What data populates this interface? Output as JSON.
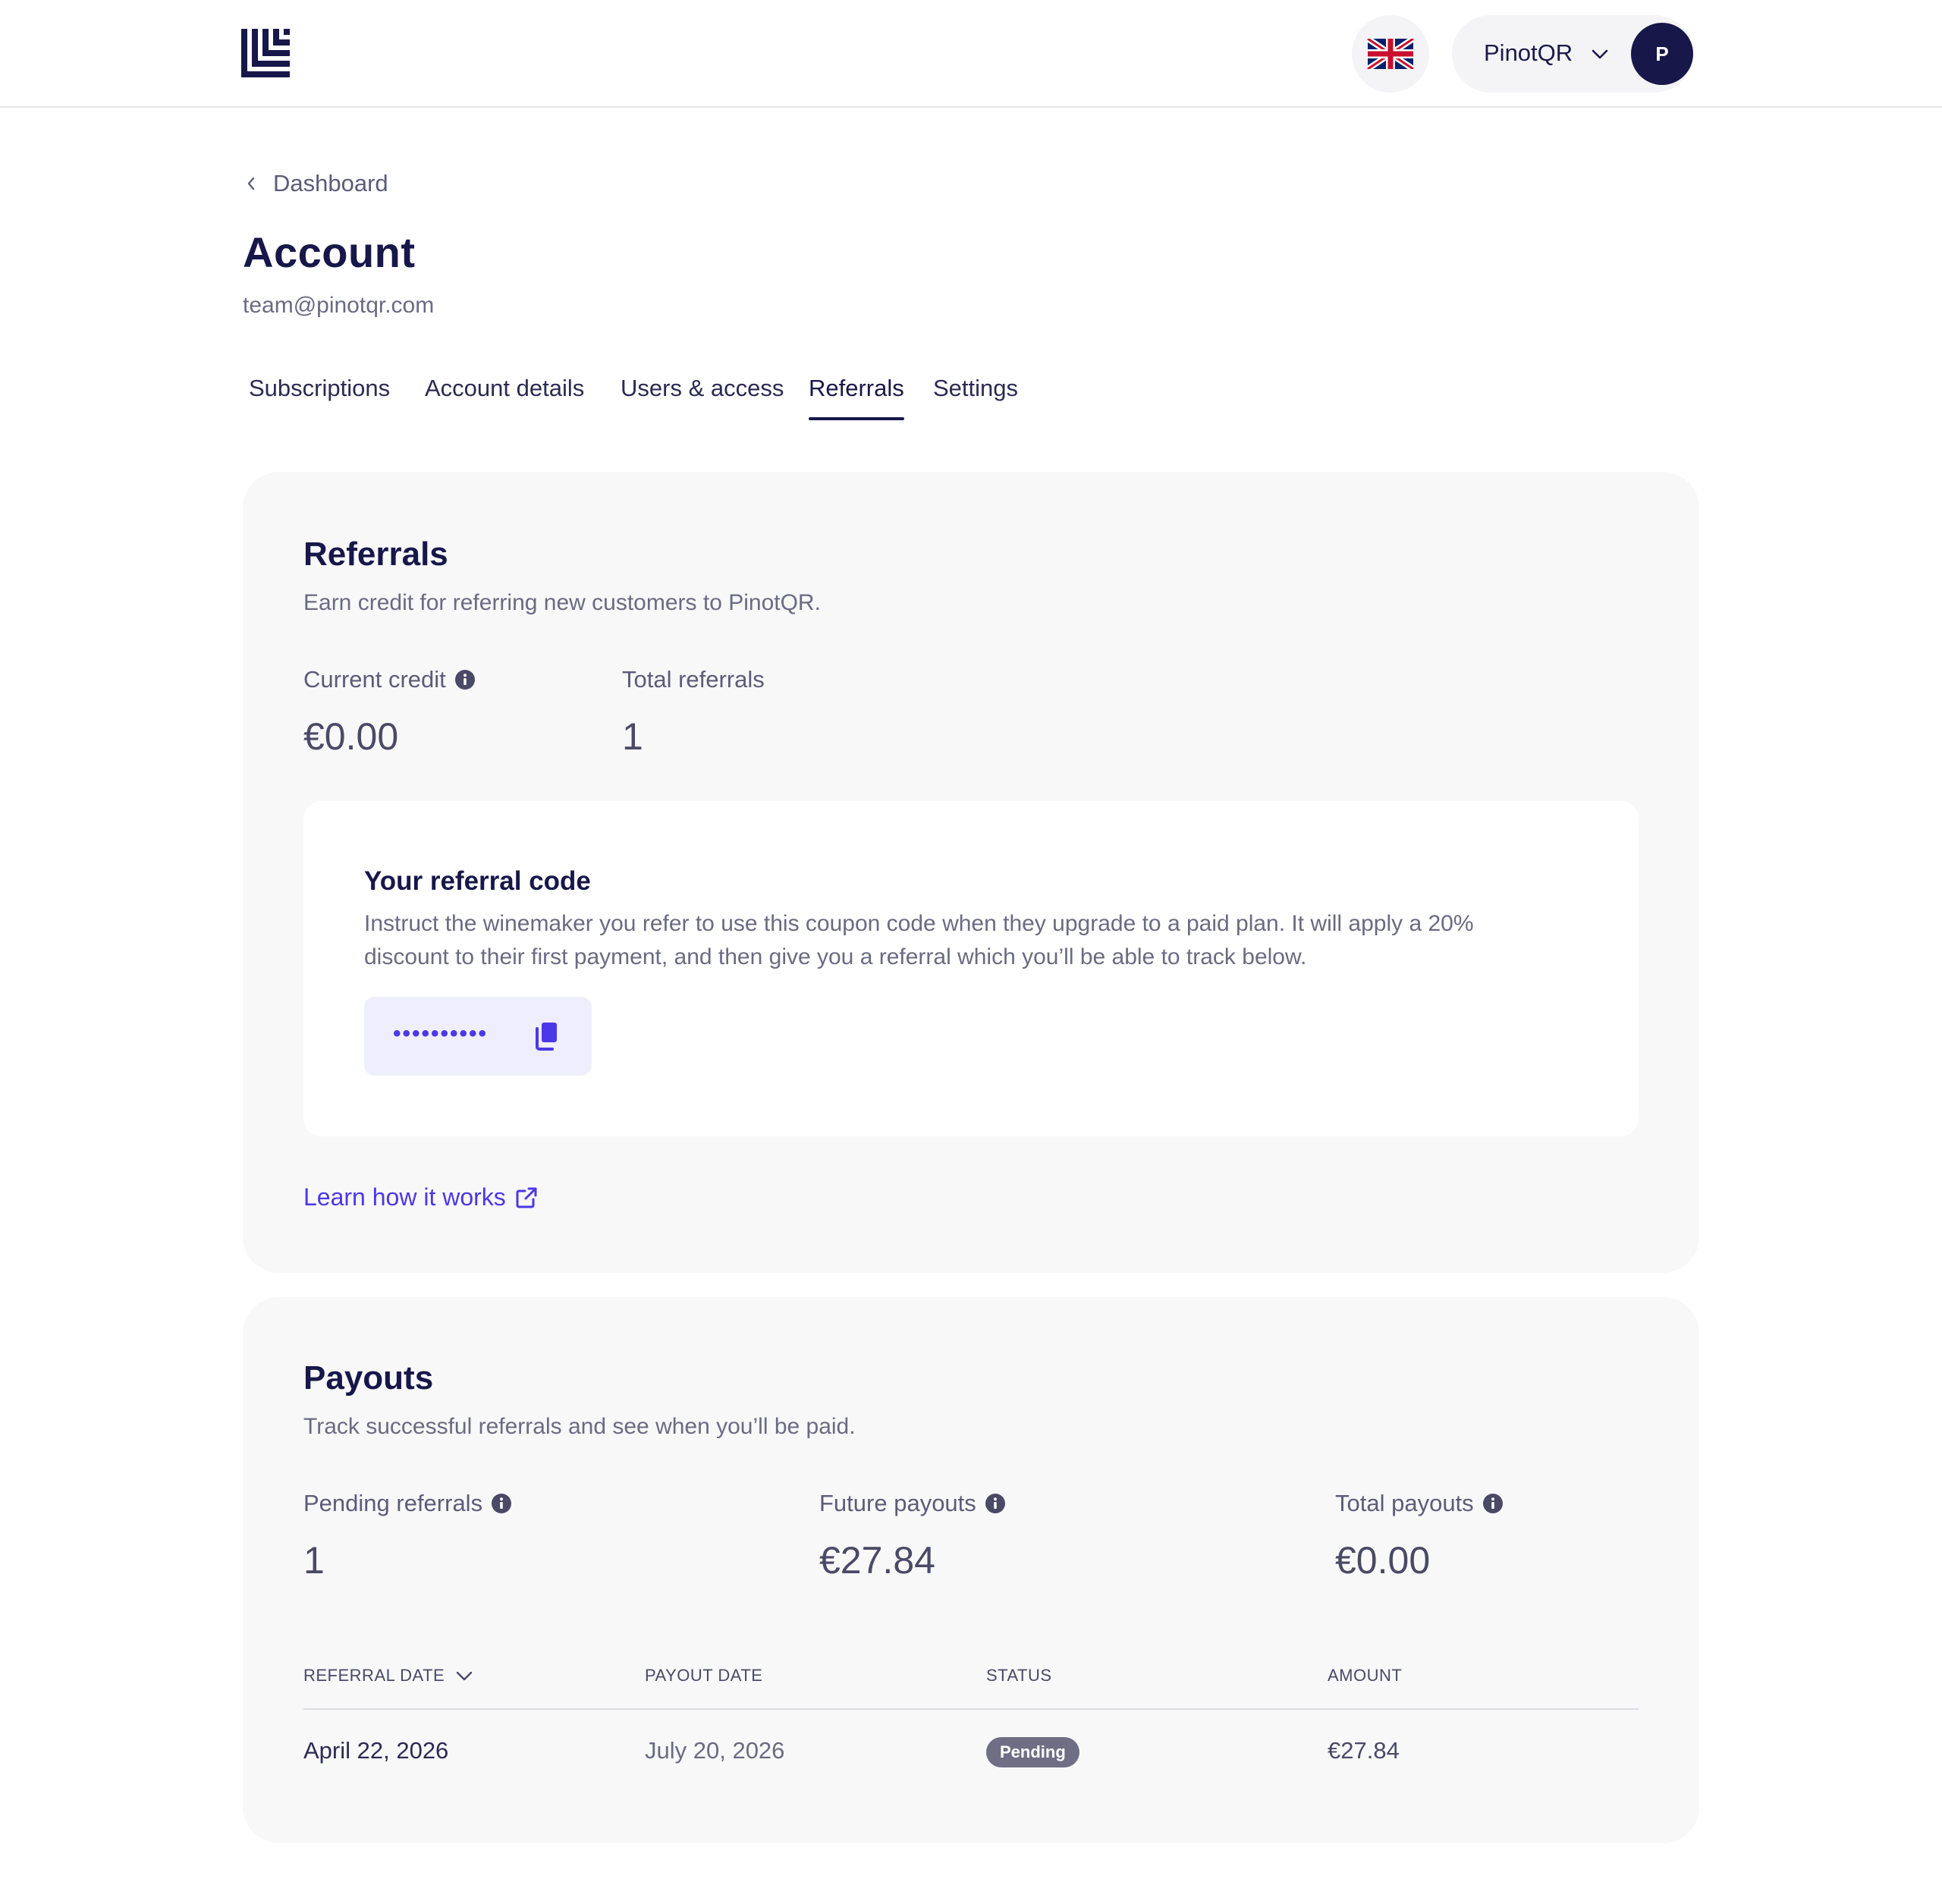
{
  "header": {
    "logo_icon": "brand-logo-icon",
    "language_icon": "uk-flag-icon",
    "account_name": "PinotQR",
    "avatar_initial": "P"
  },
  "breadcrumb": {
    "label": "Dashboard"
  },
  "page": {
    "title": "Account",
    "email": "team@pinotqr.com"
  },
  "tabs": [
    {
      "label": "Subscriptions",
      "active": false
    },
    {
      "label": "Account details",
      "active": false
    },
    {
      "label": "Users & access",
      "active": false
    },
    {
      "label": "Referrals",
      "active": true
    },
    {
      "label": "Settings",
      "active": false
    }
  ],
  "referrals": {
    "title": "Referrals",
    "subtitle": "Earn credit for referring new customers to PinotQR.",
    "current_credit_label": "Current credit",
    "current_credit_value": "€0.00",
    "total_referrals_label": "Total referrals",
    "total_referrals_value": "1",
    "code": {
      "title": "Your referral code",
      "description": "Instruct the winemaker you refer to use this coupon code when they upgrade to a paid plan. It will apply a 20% discount to their first payment, and then give you a referral which you’ll be able to track below.",
      "masked_value": "••••••••••"
    },
    "learn_link": "Learn how it works"
  },
  "payouts": {
    "title": "Payouts",
    "subtitle": "Track successful referrals and see when you’ll be paid.",
    "pending_label": "Pending referrals",
    "pending_value": "1",
    "future_label": "Future payouts",
    "future_value": "€27.84",
    "total_label": "Total payouts",
    "total_value": "€0.00",
    "table": {
      "headers": [
        "REFERRAL DATE",
        "PAYOUT DATE",
        "STATUS",
        "AMOUNT"
      ],
      "rows": [
        {
          "referral_date": "April 22, 2026",
          "payout_date": "July 20, 2026",
          "status": "Pending",
          "amount": "€27.84"
        }
      ]
    }
  },
  "colors": {
    "brand_navy": "#17174a",
    "accent": "#4b38e6",
    "card_bg": "#f8f8f9",
    "badge_bg": "#6f6e85"
  }
}
